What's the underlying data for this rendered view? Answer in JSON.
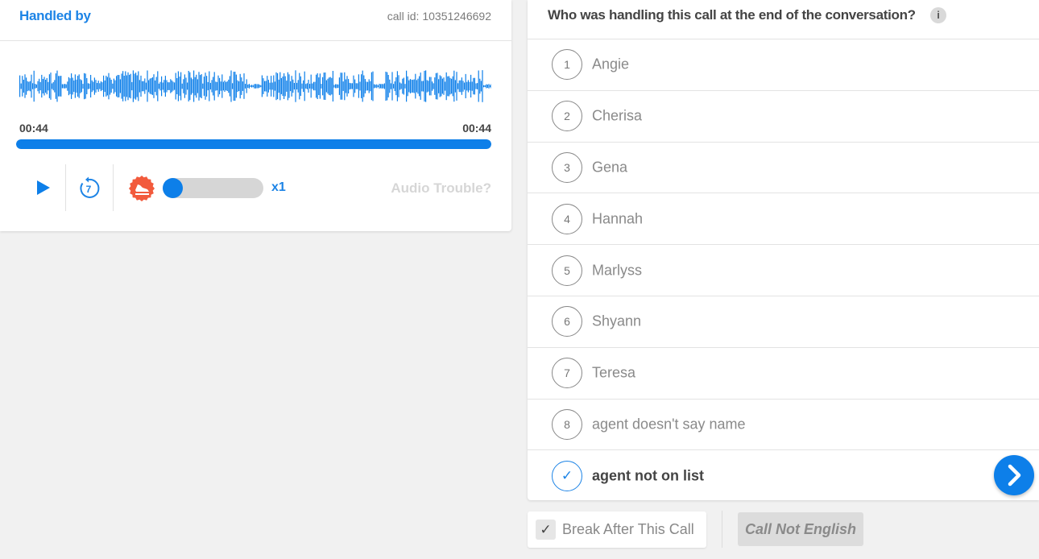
{
  "player": {
    "title": "Handled by",
    "call_id": "call id: 10351246692",
    "time_current": "00:44",
    "time_total": "00:44",
    "progress_fraction": 1.0,
    "replay_seconds": "7",
    "speed_label": "x1",
    "speed_fraction": 0.0,
    "audio_trouble_label": "Audio Trouble?",
    "accent_color": "#0d7fe9",
    "speed_icon_color": "#f25a3c"
  },
  "question": {
    "title": "Who was handling this call at the end of the conversation?",
    "info_label": "i",
    "options": [
      {
        "number": "1",
        "label": "Angie",
        "selected": false
      },
      {
        "number": "2",
        "label": "Cherisa",
        "selected": false
      },
      {
        "number": "3",
        "label": "Gena",
        "selected": false
      },
      {
        "number": "4",
        "label": "Hannah",
        "selected": false
      },
      {
        "number": "5",
        "label": "Marlyss",
        "selected": false
      },
      {
        "number": "6",
        "label": "Shyann",
        "selected": false
      },
      {
        "number": "7",
        "label": "Teresa",
        "selected": false
      },
      {
        "number": "8",
        "label": "agent doesn't say name",
        "selected": false
      },
      {
        "number": "✓",
        "label": "agent not on list",
        "selected": true
      }
    ]
  },
  "footer": {
    "break_check_mark": "✓",
    "break_label": "Break After This Call",
    "break_checked": true,
    "not_english_label": "Call Not English"
  }
}
